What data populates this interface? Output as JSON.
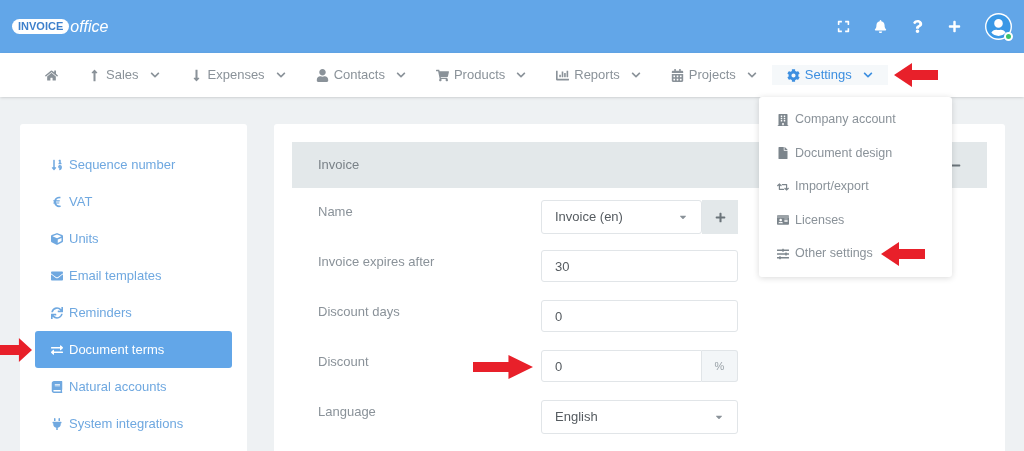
{
  "logo": {
    "badge": "INVOICE",
    "word": "office"
  },
  "nav": [
    {
      "selected": false,
      "marked": false
    },
    {
      "label": "Sales",
      "selected": false,
      "marked": false
    },
    {
      "label": "Expenses",
      "selected": false,
      "marked": false
    },
    {
      "label": "Contacts",
      "selected": false,
      "marked": false
    },
    {
      "label": "Products",
      "selected": false,
      "marked": false
    },
    {
      "label": "Reports",
      "selected": false,
      "marked": false
    },
    {
      "label": "Projects",
      "selected": false,
      "marked": false
    },
    {
      "label": "Settings",
      "selected": true,
      "marked": true
    }
  ],
  "settings_menu": [
    {
      "label": "Company account",
      "marked": false
    },
    {
      "label": "Document design",
      "marked": false
    },
    {
      "label": "Import/export",
      "marked": false
    },
    {
      "label": "Licenses",
      "marked": false
    },
    {
      "label": "Other settings",
      "marked": true
    }
  ],
  "sidebar": {
    "items": [
      {
        "label": "Sequence number",
        "selected": false,
        "marked": false
      },
      {
        "label": "VAT",
        "selected": false,
        "marked": false
      },
      {
        "label": "Units",
        "selected": false,
        "marked": false
      },
      {
        "label": "Email templates",
        "selected": false,
        "marked": false
      },
      {
        "label": "Reminders",
        "selected": false,
        "marked": false
      },
      {
        "label": "Document terms",
        "selected": true,
        "marked": true
      },
      {
        "label": "Natural accounts",
        "selected": false,
        "marked": false
      },
      {
        "label": "System integrations",
        "selected": false,
        "marked": false
      }
    ]
  },
  "section": {
    "title": "Invoice",
    "expanded": true
  },
  "form": [
    {
      "label": "Name",
      "kind": "select-add",
      "value": "Invoice (en)",
      "marked": false
    },
    {
      "label": "Invoice expires after",
      "kind": "text",
      "value": "30",
      "marked": false
    },
    {
      "label": "Discount days",
      "kind": "text",
      "value": "0",
      "marked": false
    },
    {
      "label": "Discount",
      "kind": "suffix",
      "value": "0",
      "suffix": "%",
      "marked": true
    },
    {
      "label": "Language",
      "kind": "select",
      "value": "English",
      "marked": false
    }
  ]
}
